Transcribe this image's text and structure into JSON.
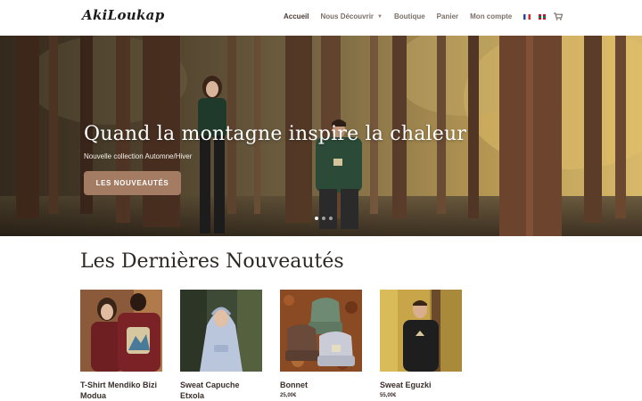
{
  "brand": {
    "logo_text": "AkiLoukap"
  },
  "nav": {
    "items": [
      {
        "label": "Accueil",
        "active": true
      },
      {
        "label": "Nous Découvrir",
        "has_dropdown": true
      },
      {
        "label": "Boutique"
      },
      {
        "label": "Panier"
      },
      {
        "label": "Mon compte"
      }
    ],
    "languages": [
      "fr-flag-icon",
      "basque-flag-icon"
    ],
    "cart_icon": "cart-icon"
  },
  "hero": {
    "title": "Quand la montagne inspire la chaleur",
    "subtitle": "Nouvelle collection Automne/Hiver",
    "button_label": "LES NOUVEAUTÉS",
    "slides": 3,
    "active_slide": 1
  },
  "section": {
    "title": "Les Dernières Nouveautés"
  },
  "products": [
    {
      "name": "T-Shirt Mendiko Bizi Modua",
      "price": ""
    },
    {
      "name": "Sweat Capuche Etxola",
      "price": ""
    },
    {
      "name": "Bonnet",
      "price": "25,00€"
    },
    {
      "name": "Sweat Eguzki",
      "price": "55,00€"
    }
  ],
  "colors": {
    "accent_button": "#a47b63",
    "nav_text": "#7b6f68",
    "heading": "#2e2723"
  }
}
